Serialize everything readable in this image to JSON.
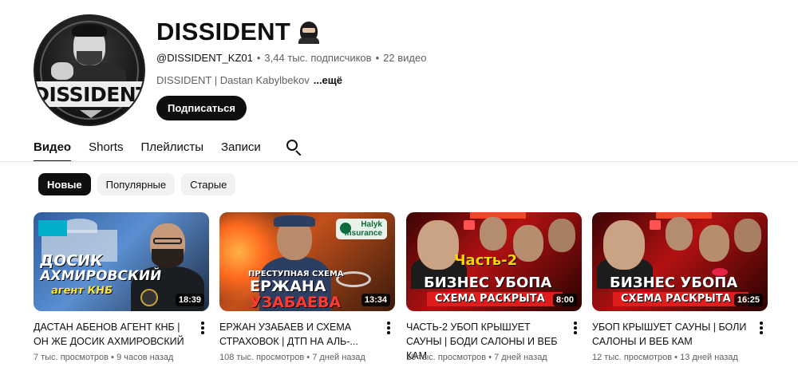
{
  "channel": {
    "title": "DISSIDENT",
    "title_emoji_icon": "ninja-icon",
    "avatar_text": "DISSIDENT",
    "handle": "@DISSIDENT_KZ01",
    "subscribers": "3,44 тыс. подписчиков",
    "videos_count": "22 видео",
    "separator": "•",
    "description": "DISSIDENT | Dastan Kabylbekov",
    "more_label": "...ещё",
    "subscribe_label": "Подписаться"
  },
  "tabs": [
    {
      "label": "Видео",
      "active": true
    },
    {
      "label": "Shorts",
      "active": false
    },
    {
      "label": "Плейлисты",
      "active": false
    },
    {
      "label": "Записи",
      "active": false
    }
  ],
  "chips": [
    {
      "label": "Новые",
      "active": true
    },
    {
      "label": "Популярные",
      "active": false
    },
    {
      "label": "Старые",
      "active": false
    }
  ],
  "videos": [
    {
      "title": "ДАСТАН АБЕНОВ АГЕНТ КНБ | ОН ЖЕ ДОСИК АХМИРОВСКИЙ",
      "views": "7 тыс. просмотров",
      "age": "9 часов назад",
      "duration": "18:39",
      "thumb_lines": [
        "ДОСИК",
        "АХМИРОВСКИЙ",
        "агент КНБ"
      ]
    },
    {
      "title": "ЕРЖАН УЗАБАЕВ И СХЕМА СТРАХОВОК | ДТП НА АЛЬ-...",
      "views": "108 тыс. просмотров",
      "age": "7 дней назад",
      "duration": "13:34",
      "thumb_lines": [
        "ПРЕСТУПНАЯ СХЕМА",
        "ЕРЖАНА",
        "УЗАБАЕВА"
      ],
      "thumb_logo": [
        "Halyk",
        "Insurance"
      ]
    },
    {
      "title": "ЧАСТЬ-2 УБОП КРЫШУЕТ САУНЫ | БОДИ САЛОНЫ И ВЕБ КАМ",
      "views": "10 тыс. просмотров",
      "age": "7 дней назад",
      "duration": "8:00",
      "thumb_lines": [
        "Часть-2",
        "БИЗНЕС УБОПА",
        "СХЕМА РАСКРЫТА"
      ]
    },
    {
      "title": "УБОП КРЫШУЕТ САУНЫ | БОЛИ САЛОНЫ И ВЕБ КАМ",
      "views": "12 тыс. просмотров",
      "age": "13 дней назад",
      "duration": "16:25",
      "thumb_lines": [
        "БИЗНЕС УБОПА",
        "СХЕМА РАСКРЫТА"
      ]
    }
  ],
  "colors": {
    "text_primary": "#0f0f0f",
    "text_secondary": "#606060",
    "chip_bg": "#f2f2f2",
    "button_bg": "#0f0f0f"
  }
}
